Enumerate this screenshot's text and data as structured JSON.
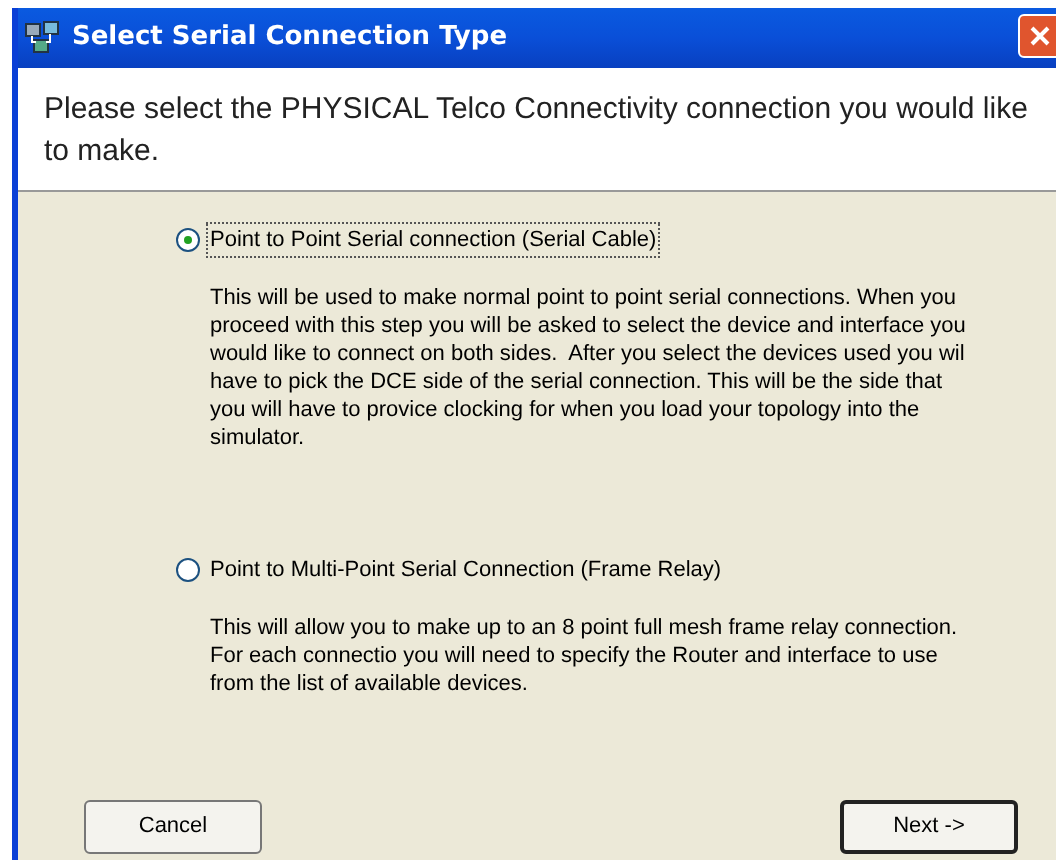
{
  "window": {
    "title": "Select Serial Connection Type"
  },
  "header": {
    "text": "Please select the PHYSICAL Telco Connectivity connection you would like to make."
  },
  "options": [
    {
      "label": "Point to Point Serial connection (Serial Cable)",
      "selected": true,
      "description": "This will be used to make normal point to point serial connections. When you proceed with this step you will be asked to select the device and interface you would like to connect on both sides.  After you select the devices used you wil have to pick the DCE side of the serial connection. This will be the side that you will have to provice clocking for when you load your topology into the simulator."
    },
    {
      "label": "Point to Multi-Point Serial Connection (Frame Relay)",
      "selected": false,
      "description": "This will allow you to make up to an 8 point full mesh frame relay connection. For each connectio you will need to specify the Router and interface to use from the list of available devices."
    }
  ],
  "buttons": [
    {
      "label": "Cancel",
      "kind": "cancel"
    },
    {
      "label": "Next ->",
      "kind": "next"
    }
  ]
}
